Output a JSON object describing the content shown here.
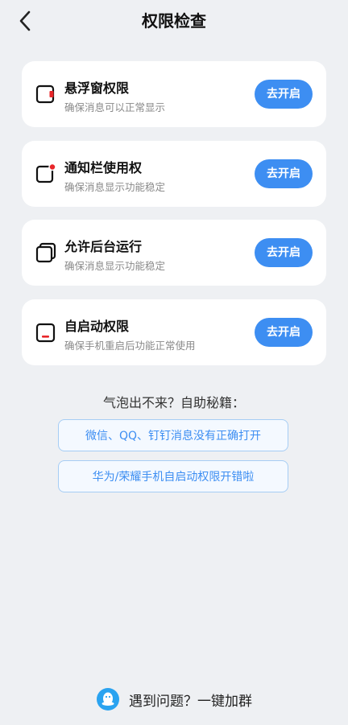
{
  "header": {
    "back_icon": "chevron-left-icon",
    "title": "权限检查"
  },
  "permissions": [
    {
      "name": "悬浮窗权限",
      "desc": "确保消息可以正常显示",
      "button": "去开启",
      "icon": "floating-window-icon"
    },
    {
      "name": "通知栏使用权",
      "desc": "确保消息显示功能稳定",
      "button": "去开启",
      "icon": "notification-icon"
    },
    {
      "name": "允许后台运行",
      "desc": "确保消息显示功能稳定",
      "button": "去开启",
      "icon": "background-run-icon"
    },
    {
      "name": "自启动权限",
      "desc": "确保手机重启后功能正常使用",
      "button": "去开启",
      "icon": "auto-start-icon"
    }
  ],
  "help": {
    "title": "气泡出不来？自助秘籍：",
    "links": [
      "微信、QQ、钉钉消息没有正确打开",
      "华为/荣耀手机自启动权限开错啦"
    ]
  },
  "footer": {
    "icon": "qq-icon",
    "text": "遇到问题？一键加群"
  },
  "colors": {
    "accent": "#3d8ef2",
    "background": "#eef0f3",
    "indicator_red": "#e8262a"
  }
}
